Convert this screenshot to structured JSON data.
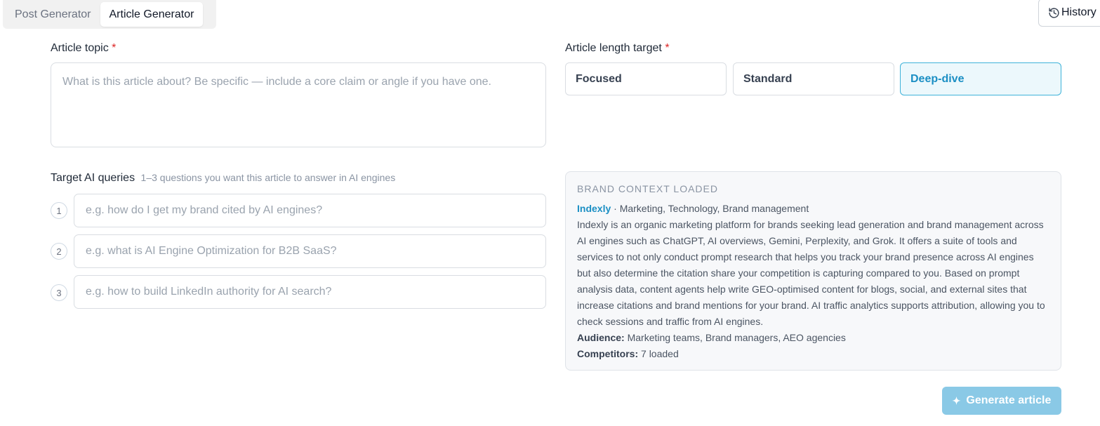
{
  "tabs": [
    {
      "label": "Post Generator",
      "active": false
    },
    {
      "label": "Article Generator",
      "active": true
    }
  ],
  "history": {
    "label": "History",
    "icon": "history-icon"
  },
  "topic": {
    "label": "Article topic",
    "required": "*",
    "placeholder": "What is this article about? Be specific — include a core claim or angle if you have one.",
    "value": ""
  },
  "length": {
    "label": "Article length target",
    "required": "*",
    "options": [
      "Focused",
      "Standard",
      "Deep-dive"
    ],
    "selected": "Deep-dive"
  },
  "queries": {
    "label": "Target AI queries",
    "hint": "1–3 questions you want this article to answer in AI engines",
    "items": [
      {
        "num": "1",
        "placeholder": "e.g. how do I get my brand cited by AI engines?"
      },
      {
        "num": "2",
        "placeholder": "e.g. what is AI Engine Optimization for B2B SaaS?"
      },
      {
        "num": "3",
        "placeholder": "e.g. how to build LinkedIn authority for AI search?"
      }
    ]
  },
  "brand": {
    "title": "BRAND CONTEXT LOADED",
    "name": "Indexly",
    "industries": " · Marketing, Technology, Brand management",
    "description": "Indexly is an organic marketing platform for brands seeking lead generation and brand management across AI engines such as ChatGPT, AI overviews, Gemini, Perplexity, and Grok. It offers a suite of tools and services to not only conduct prompt research that helps you track your brand presence across AI engines but also determine the citation share your competition is capturing compared to you. Based on prompt analysis data, content agents help write GEO-optimised content for blogs, social, and external sites that increase citations and brand mentions for your brand. AI traffic analytics supports attribution, allowing you to check sessions and traffic from AI engines.",
    "audience_label": "Audience:",
    "audience": " Marketing teams, Brand managers, AEO agencies",
    "competitors_label": "Competitors:",
    "competitors": " 7 loaded"
  },
  "generate": {
    "label": "Generate article",
    "icon": "sparkle-icon"
  },
  "colors": {
    "accent": "#1b8fc4",
    "required": "#dc2626",
    "button_disabled": "#8ac9e6"
  }
}
